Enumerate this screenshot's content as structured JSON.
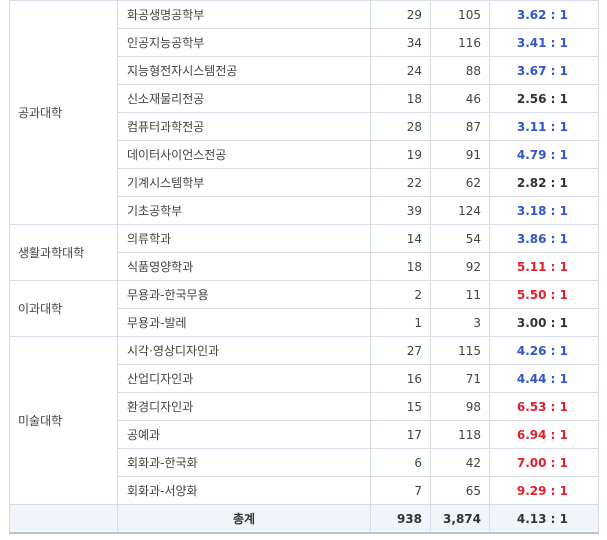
{
  "colors": {
    "low": "#3355cc",
    "mid": "#333333",
    "high": "#e0202a"
  },
  "groups": [
    {
      "college": "공과대학",
      "rows": [
        {
          "dept": "화공생명공학부",
          "quota": "29",
          "applicants": "105",
          "rate": "3.62 : 1",
          "tone": "low"
        },
        {
          "dept": "인공지능공학부",
          "quota": "34",
          "applicants": "116",
          "rate": "3.41 : 1",
          "tone": "low"
        },
        {
          "dept": "지능형전자시스템전공",
          "quota": "24",
          "applicants": "88",
          "rate": "3.67 : 1",
          "tone": "low"
        },
        {
          "dept": "신소재물리전공",
          "quota": "18",
          "applicants": "46",
          "rate": "2.56 : 1",
          "tone": "mid"
        },
        {
          "dept": "컴퓨터과학전공",
          "quota": "28",
          "applicants": "87",
          "rate": "3.11 : 1",
          "tone": "low"
        },
        {
          "dept": "데이터사이언스전공",
          "quota": "19",
          "applicants": "91",
          "rate": "4.79 : 1",
          "tone": "low"
        },
        {
          "dept": "기계시스템학부",
          "quota": "22",
          "applicants": "62",
          "rate": "2.82 : 1",
          "tone": "mid"
        },
        {
          "dept": "기초공학부",
          "quota": "39",
          "applicants": "124",
          "rate": "3.18 : 1",
          "tone": "low"
        }
      ]
    },
    {
      "college": "생활과학대학",
      "rows": [
        {
          "dept": "의류학과",
          "quota": "14",
          "applicants": "54",
          "rate": "3.86 : 1",
          "tone": "low"
        },
        {
          "dept": "식품영양학과",
          "quota": "18",
          "applicants": "92",
          "rate": "5.11 : 1",
          "tone": "high"
        }
      ]
    },
    {
      "college": "이과대학",
      "rows": [
        {
          "dept": "무용과-한국무용",
          "quota": "2",
          "applicants": "11",
          "rate": "5.50 : 1",
          "tone": "high"
        },
        {
          "dept": "무용과-발레",
          "quota": "1",
          "applicants": "3",
          "rate": "3.00 : 1",
          "tone": "mid"
        }
      ]
    },
    {
      "college": "미술대학",
      "rows": [
        {
          "dept": "시각·영상디자인과",
          "quota": "27",
          "applicants": "115",
          "rate": "4.26 : 1",
          "tone": "low"
        },
        {
          "dept": "산업디자인과",
          "quota": "16",
          "applicants": "71",
          "rate": "4.44 : 1",
          "tone": "low"
        },
        {
          "dept": "환경디자인과",
          "quota": "15",
          "applicants": "98",
          "rate": "6.53 : 1",
          "tone": "high"
        },
        {
          "dept": "공예과",
          "quota": "17",
          "applicants": "118",
          "rate": "6.94 : 1",
          "tone": "high"
        },
        {
          "dept": "회화과-한국화",
          "quota": "6",
          "applicants": "42",
          "rate": "7.00 : 1",
          "tone": "high"
        },
        {
          "dept": "회화과-서양화",
          "quota": "7",
          "applicants": "65",
          "rate": "9.29 : 1",
          "tone": "high"
        }
      ]
    }
  ],
  "total": {
    "label": "총계",
    "quota": "938",
    "applicants": "3,874",
    "rate": "4.13 : 1"
  }
}
